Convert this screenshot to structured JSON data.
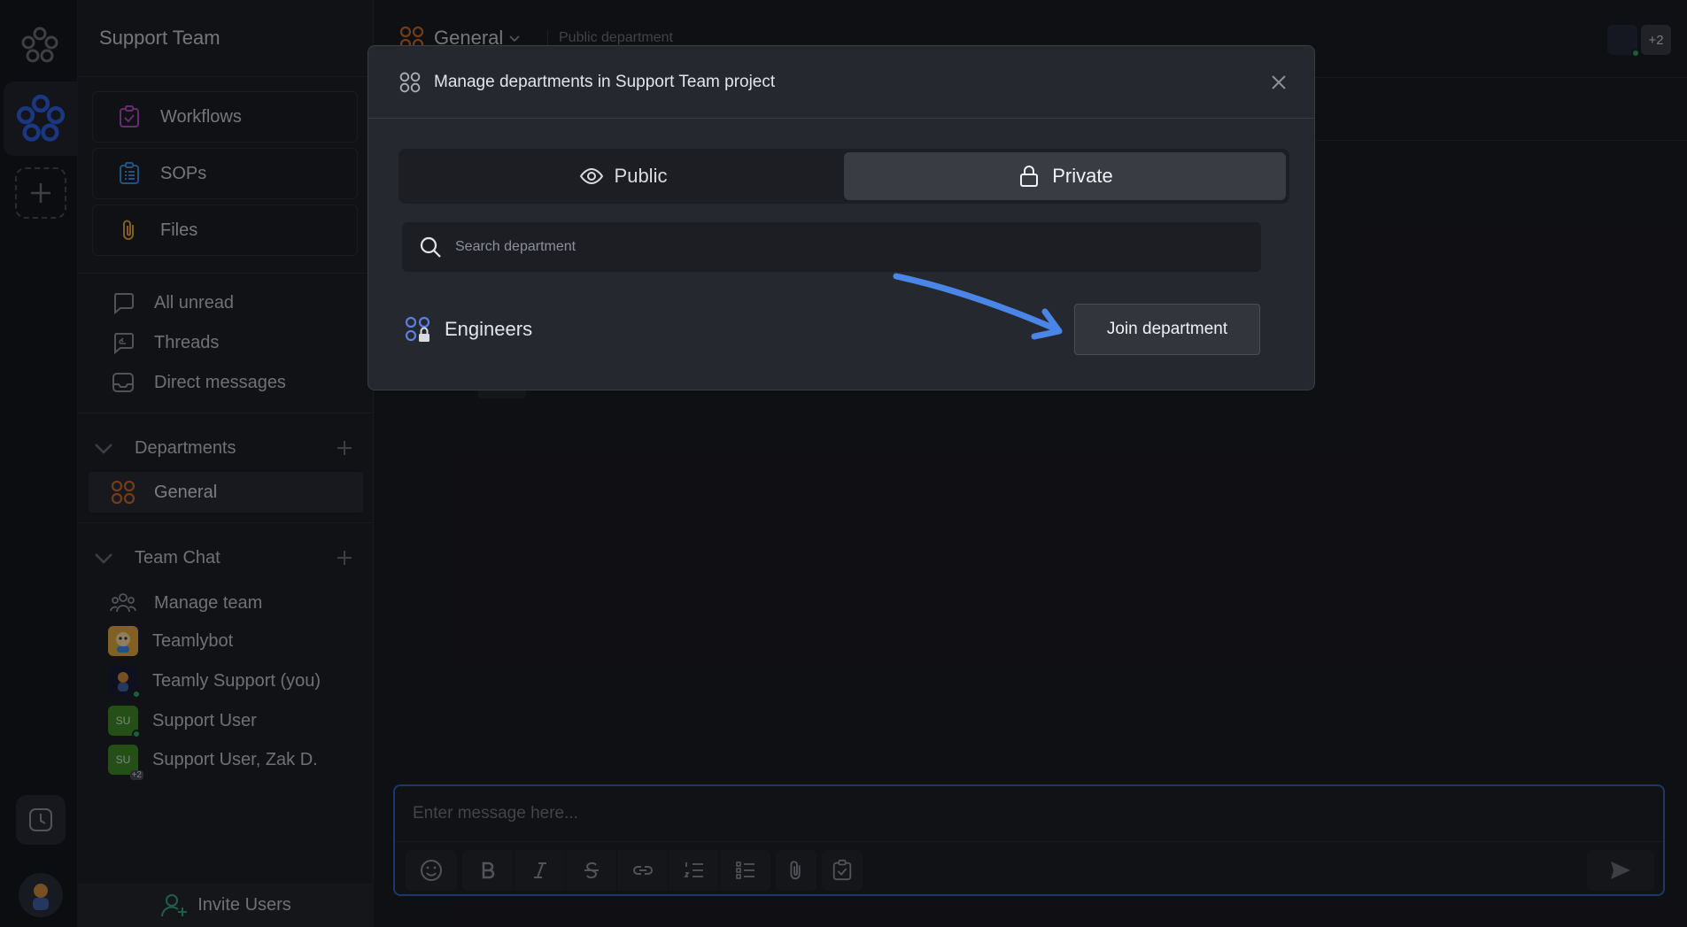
{
  "sidebar": {
    "title": "Support Team",
    "tools": [
      {
        "label": "Workflows",
        "icon": "clipboard-check-icon",
        "color": "#b04cc2"
      },
      {
        "label": "SOPs",
        "icon": "list-clipboard-icon",
        "color": "#3d8fd6"
      },
      {
        "label": "Files",
        "icon": "paperclip-icon",
        "color": "#d9a23b"
      }
    ],
    "nav": [
      {
        "label": "All unread",
        "icon": "chat-bubble-icon"
      },
      {
        "label": "Threads",
        "icon": "threads-icon"
      },
      {
        "label": "Direct messages",
        "icon": "inbox-icon"
      }
    ],
    "departments": {
      "header": "Departments",
      "items": [
        {
          "label": "General",
          "icon": "department-grid-icon",
          "color": "#c86a2a"
        }
      ]
    },
    "team_chat": {
      "header": "Team Chat",
      "items": [
        {
          "label": "Manage team",
          "type": "icon"
        },
        {
          "label": "Teamlybot",
          "type": "avatar"
        },
        {
          "label": "Teamly Support (you)",
          "type": "avatar"
        },
        {
          "label": "Support User",
          "type": "initials",
          "initials": "SU"
        },
        {
          "label": "Support User, Zak D.",
          "type": "initials",
          "initials": "SU",
          "badge": "+2"
        }
      ]
    },
    "invite_label": "Invite Users"
  },
  "main": {
    "title": "General",
    "subtitle": "Public department",
    "extra_members": "+2",
    "composer_placeholder": "Enter message here..."
  },
  "modal": {
    "title": "Manage departments in Support Team project",
    "tabs": [
      {
        "label": "Public",
        "active": false
      },
      {
        "label": "Private",
        "active": true
      }
    ],
    "search_placeholder": "Search department",
    "department": {
      "name": "Engineers"
    },
    "join_label": "Join department"
  },
  "colors": {
    "accent": "#2f5fb8",
    "arrow": "#4a86e8",
    "online": "#2ea36a"
  }
}
